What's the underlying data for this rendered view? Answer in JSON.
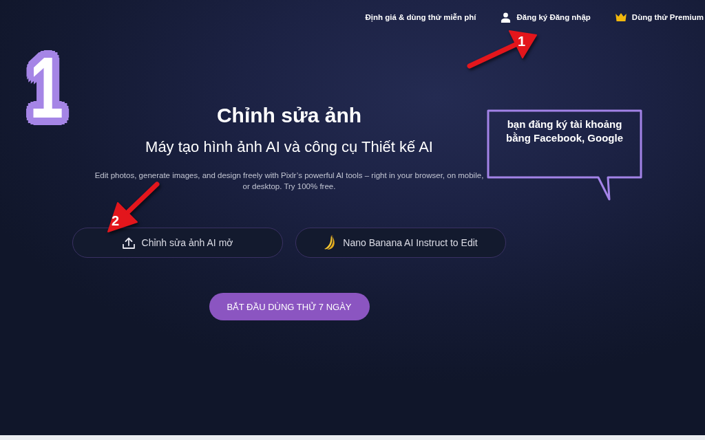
{
  "nav": {
    "items": [
      {
        "kind": "link",
        "label": "Định giá & dùng thử miễn phí"
      },
      {
        "kind": "account",
        "label": "Đăng ký Đăng nhập"
      },
      {
        "kind": "premium",
        "label": "Dùng thử Premium"
      }
    ]
  },
  "hero": {
    "title": "Chỉnh sửa ảnh",
    "subtitle": "Máy tạo hình ảnh AI và công cụ Thiết kế AI",
    "description": "Edit photos, generate images, and design freely with Pixlr’s powerful AI tools – right in your browser, on mobile, or desktop. Try 100% free."
  },
  "actions": [
    {
      "kind": "upload",
      "label": "Chỉnh sửa ảnh AI mở"
    },
    {
      "kind": "banana",
      "label": "Nano Banana AI Instruct to Edit"
    }
  ],
  "cta": {
    "label": "BẮT ĐẦU DÙNG THỬ 7 NGÀY"
  },
  "annotations": {
    "step_badge": "1",
    "callout": "bạn đăng ký tài khoảng bằng Facebook, Google",
    "arrows": [
      {
        "label": "1"
      },
      {
        "label": "2"
      }
    ]
  }
}
